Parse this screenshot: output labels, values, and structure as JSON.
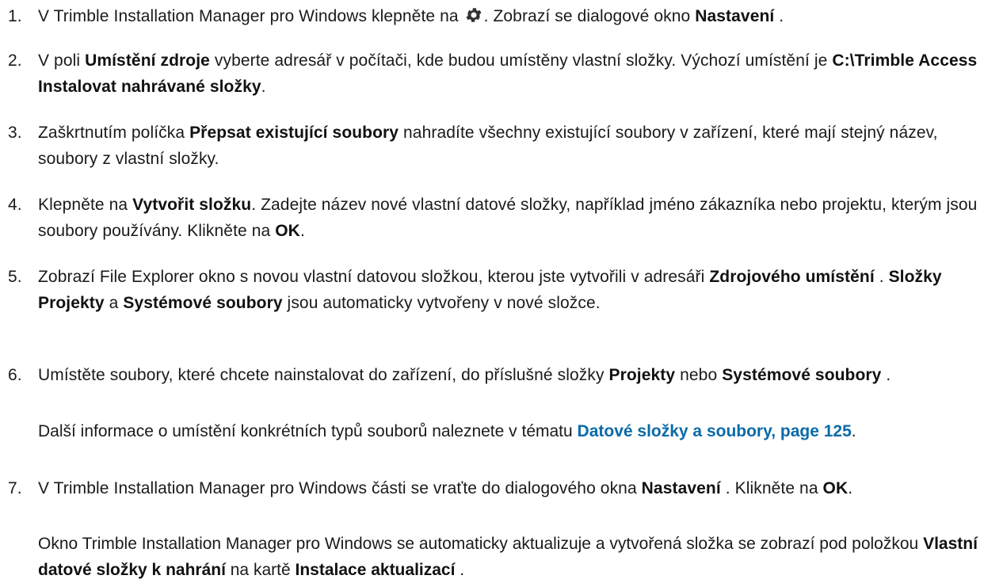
{
  "steps": [
    {
      "num": "1.",
      "p1": "V Trimble Installation Manager pro Windows klepněte na ",
      "p2": ". Zobrazí se dialogové okno ",
      "b1": "Nastavení",
      "p3": " ."
    },
    {
      "num": "2.",
      "p1": "V poli ",
      "b1": "Umístění zdroje",
      "p2": " vyberte adresář v počítači, kde budou umístěny vlastní složky. Výchozí umístění je ",
      "b2": "C:\\Trimble Access Instalovat nahrávané složky",
      "p3": "."
    },
    {
      "num": "3.",
      "p1": "Zaškrtnutím políčka ",
      "b1": "Přepsat existující soubory",
      "p2": " nahradíte všechny existující soubory v zařízení, které mají stejný název, soubory z vlastní složky."
    },
    {
      "num": "4.",
      "p1": "Klepněte na ",
      "b1": "Vytvořit složku",
      "p2": ". Zadejte název nové vlastní datové složky, například jméno zákazníka nebo projektu, kterým jsou soubory používány. Klikněte na ",
      "b2": "OK",
      "p3": "."
    },
    {
      "num": "5.",
      "p1": "Zobrazí File Explorer okno s novou vlastní datovou složkou, kterou jste vytvořili v adresáři ",
      "b1": "Zdrojového umístění",
      "p2": " . ",
      "b2": "Složky Projekty",
      "p3": " a ",
      "b3": "Systémové soubory",
      "p4": " jsou automaticky vytvořeny v nové složce."
    },
    {
      "num": "6.",
      "p1": "Umístěte soubory, které chcete nainstalovat do zařízení, do příslušné složky ",
      "b1": "Projekty",
      "p2": " nebo ",
      "b2": "Systémové soubory",
      "p3": " .",
      "note_p1": "Další informace o umístění konkrétních typů souborů naleznete v tématu ",
      "note_link": "Datové složky a soubory, page 125",
      "note_p2": "."
    },
    {
      "num": "7.",
      "p1": "V Trimble Installation Manager pro Windows části se vraťte do dialogového okna ",
      "b1": "Nastavení",
      "p2": " . Klikněte na ",
      "b2": "OK",
      "p3": ".",
      "note_p1": "Okno Trimble Installation Manager pro Windows se automaticky aktualizuje a vytvořená složka se zobrazí pod položkou ",
      "note_b1": "Vlastní datové složky k nahrání",
      "note_p2": " na kartě ",
      "note_b2": "Instalace aktualizací",
      "note_p3": " ."
    }
  ],
  "icons": {
    "settings": "gear-icon"
  },
  "colors": {
    "link": "#0a6aa8",
    "text": "#1a1a1a"
  }
}
